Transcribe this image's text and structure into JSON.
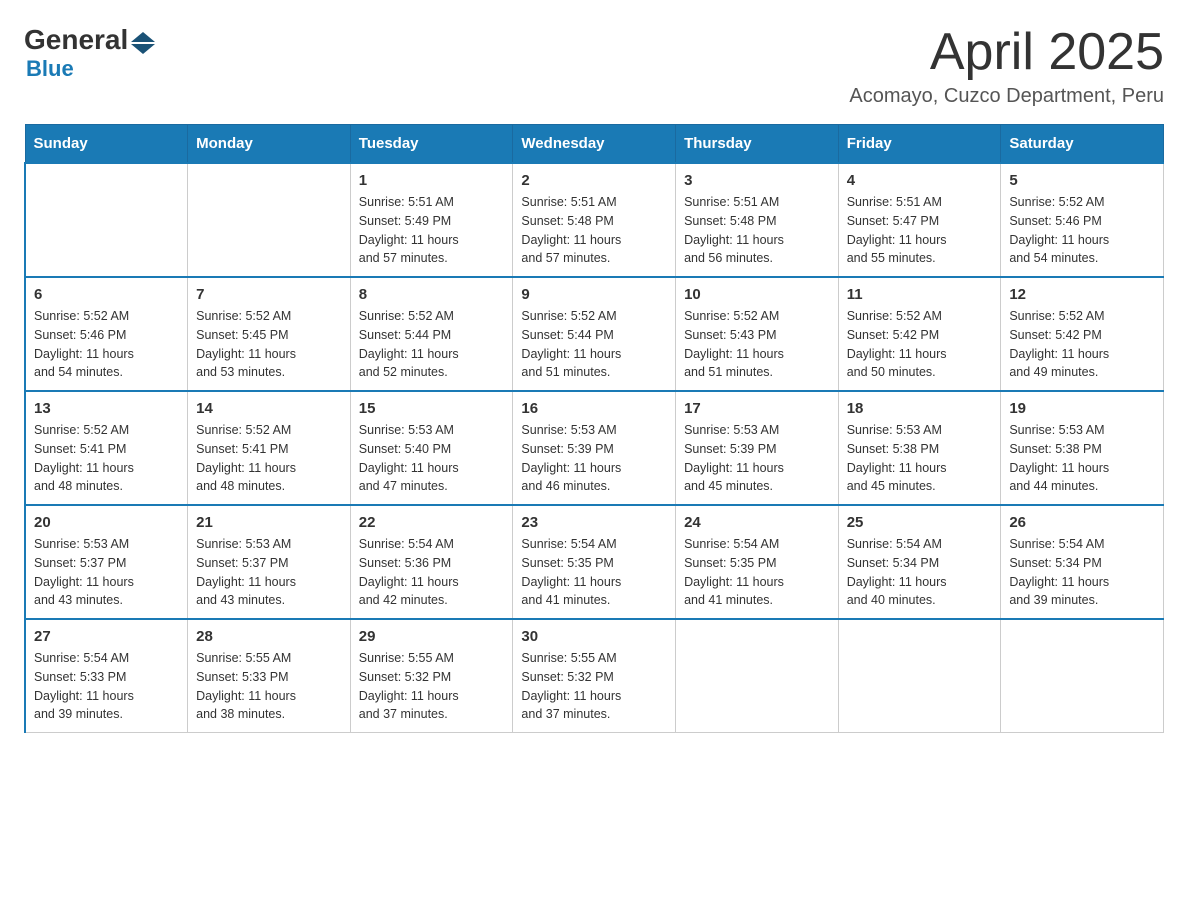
{
  "logo": {
    "general": "General",
    "blue": "Blue"
  },
  "title": "April 2025",
  "subtitle": "Acomayo, Cuzco Department, Peru",
  "days_of_week": [
    "Sunday",
    "Monday",
    "Tuesday",
    "Wednesday",
    "Thursday",
    "Friday",
    "Saturday"
  ],
  "weeks": [
    [
      {
        "day": "",
        "sunrise": "",
        "sunset": "",
        "daylight": ""
      },
      {
        "day": "",
        "sunrise": "",
        "sunset": "",
        "daylight": ""
      },
      {
        "day": "1",
        "sunrise": "Sunrise: 5:51 AM",
        "sunset": "Sunset: 5:49 PM",
        "daylight": "Daylight: 11 hours and 57 minutes."
      },
      {
        "day": "2",
        "sunrise": "Sunrise: 5:51 AM",
        "sunset": "Sunset: 5:48 PM",
        "daylight": "Daylight: 11 hours and 57 minutes."
      },
      {
        "day": "3",
        "sunrise": "Sunrise: 5:51 AM",
        "sunset": "Sunset: 5:48 PM",
        "daylight": "Daylight: 11 hours and 56 minutes."
      },
      {
        "day": "4",
        "sunrise": "Sunrise: 5:51 AM",
        "sunset": "Sunset: 5:47 PM",
        "daylight": "Daylight: 11 hours and 55 minutes."
      },
      {
        "day": "5",
        "sunrise": "Sunrise: 5:52 AM",
        "sunset": "Sunset: 5:46 PM",
        "daylight": "Daylight: 11 hours and 54 minutes."
      }
    ],
    [
      {
        "day": "6",
        "sunrise": "Sunrise: 5:52 AM",
        "sunset": "Sunset: 5:46 PM",
        "daylight": "Daylight: 11 hours and 54 minutes."
      },
      {
        "day": "7",
        "sunrise": "Sunrise: 5:52 AM",
        "sunset": "Sunset: 5:45 PM",
        "daylight": "Daylight: 11 hours and 53 minutes."
      },
      {
        "day": "8",
        "sunrise": "Sunrise: 5:52 AM",
        "sunset": "Sunset: 5:44 PM",
        "daylight": "Daylight: 11 hours and 52 minutes."
      },
      {
        "day": "9",
        "sunrise": "Sunrise: 5:52 AM",
        "sunset": "Sunset: 5:44 PM",
        "daylight": "Daylight: 11 hours and 51 minutes."
      },
      {
        "day": "10",
        "sunrise": "Sunrise: 5:52 AM",
        "sunset": "Sunset: 5:43 PM",
        "daylight": "Daylight: 11 hours and 51 minutes."
      },
      {
        "day": "11",
        "sunrise": "Sunrise: 5:52 AM",
        "sunset": "Sunset: 5:42 PM",
        "daylight": "Daylight: 11 hours and 50 minutes."
      },
      {
        "day": "12",
        "sunrise": "Sunrise: 5:52 AM",
        "sunset": "Sunset: 5:42 PM",
        "daylight": "Daylight: 11 hours and 49 minutes."
      }
    ],
    [
      {
        "day": "13",
        "sunrise": "Sunrise: 5:52 AM",
        "sunset": "Sunset: 5:41 PM",
        "daylight": "Daylight: 11 hours and 48 minutes."
      },
      {
        "day": "14",
        "sunrise": "Sunrise: 5:52 AM",
        "sunset": "Sunset: 5:41 PM",
        "daylight": "Daylight: 11 hours and 48 minutes."
      },
      {
        "day": "15",
        "sunrise": "Sunrise: 5:53 AM",
        "sunset": "Sunset: 5:40 PM",
        "daylight": "Daylight: 11 hours and 47 minutes."
      },
      {
        "day": "16",
        "sunrise": "Sunrise: 5:53 AM",
        "sunset": "Sunset: 5:39 PM",
        "daylight": "Daylight: 11 hours and 46 minutes."
      },
      {
        "day": "17",
        "sunrise": "Sunrise: 5:53 AM",
        "sunset": "Sunset: 5:39 PM",
        "daylight": "Daylight: 11 hours and 45 minutes."
      },
      {
        "day": "18",
        "sunrise": "Sunrise: 5:53 AM",
        "sunset": "Sunset: 5:38 PM",
        "daylight": "Daylight: 11 hours and 45 minutes."
      },
      {
        "day": "19",
        "sunrise": "Sunrise: 5:53 AM",
        "sunset": "Sunset: 5:38 PM",
        "daylight": "Daylight: 11 hours and 44 minutes."
      }
    ],
    [
      {
        "day": "20",
        "sunrise": "Sunrise: 5:53 AM",
        "sunset": "Sunset: 5:37 PM",
        "daylight": "Daylight: 11 hours and 43 minutes."
      },
      {
        "day": "21",
        "sunrise": "Sunrise: 5:53 AM",
        "sunset": "Sunset: 5:37 PM",
        "daylight": "Daylight: 11 hours and 43 minutes."
      },
      {
        "day": "22",
        "sunrise": "Sunrise: 5:54 AM",
        "sunset": "Sunset: 5:36 PM",
        "daylight": "Daylight: 11 hours and 42 minutes."
      },
      {
        "day": "23",
        "sunrise": "Sunrise: 5:54 AM",
        "sunset": "Sunset: 5:35 PM",
        "daylight": "Daylight: 11 hours and 41 minutes."
      },
      {
        "day": "24",
        "sunrise": "Sunrise: 5:54 AM",
        "sunset": "Sunset: 5:35 PM",
        "daylight": "Daylight: 11 hours and 41 minutes."
      },
      {
        "day": "25",
        "sunrise": "Sunrise: 5:54 AM",
        "sunset": "Sunset: 5:34 PM",
        "daylight": "Daylight: 11 hours and 40 minutes."
      },
      {
        "day": "26",
        "sunrise": "Sunrise: 5:54 AM",
        "sunset": "Sunset: 5:34 PM",
        "daylight": "Daylight: 11 hours and 39 minutes."
      }
    ],
    [
      {
        "day": "27",
        "sunrise": "Sunrise: 5:54 AM",
        "sunset": "Sunset: 5:33 PM",
        "daylight": "Daylight: 11 hours and 39 minutes."
      },
      {
        "day": "28",
        "sunrise": "Sunrise: 5:55 AM",
        "sunset": "Sunset: 5:33 PM",
        "daylight": "Daylight: 11 hours and 38 minutes."
      },
      {
        "day": "29",
        "sunrise": "Sunrise: 5:55 AM",
        "sunset": "Sunset: 5:32 PM",
        "daylight": "Daylight: 11 hours and 37 minutes."
      },
      {
        "day": "30",
        "sunrise": "Sunrise: 5:55 AM",
        "sunset": "Sunset: 5:32 PM",
        "daylight": "Daylight: 11 hours and 37 minutes."
      },
      {
        "day": "",
        "sunrise": "",
        "sunset": "",
        "daylight": ""
      },
      {
        "day": "",
        "sunrise": "",
        "sunset": "",
        "daylight": ""
      },
      {
        "day": "",
        "sunrise": "",
        "sunset": "",
        "daylight": ""
      }
    ]
  ]
}
